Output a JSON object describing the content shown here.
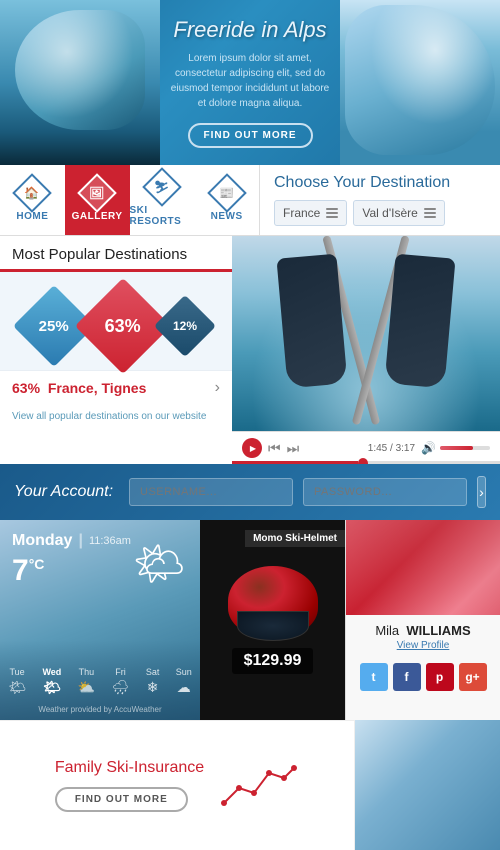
{
  "hero": {
    "title": "Freeride in Alps",
    "description": "Lorem ipsum dolor sit amet, consectetur adipiscing elit, sed do eiusmod tempor incididunt ut labore et dolore magna aliqua.",
    "button_label": "FIND OUT MORE"
  },
  "nav": {
    "tabs": [
      {
        "id": "home",
        "label": "HOME",
        "icon": "house"
      },
      {
        "id": "gallery",
        "label": "GALLERY",
        "icon": "image",
        "active": true
      },
      {
        "id": "ski-resorts",
        "label": "SKI RESORTS",
        "icon": "mountain"
      },
      {
        "id": "news",
        "label": "NEWS",
        "icon": "newspaper"
      }
    ]
  },
  "destination": {
    "title": "Choose Your Destination",
    "country": "France",
    "resort": "Val d'Isère"
  },
  "popular": {
    "title": "Most Popular Destinations",
    "diamonds": [
      {
        "label": "25%",
        "size": "medium",
        "color": "blue"
      },
      {
        "label": "63%",
        "size": "large",
        "color": "red"
      },
      {
        "label": "12%",
        "size": "small",
        "color": "dark"
      }
    ],
    "stat_percent": "63%",
    "stat_location": "France, Tignes",
    "link_text": "View all popular destinations on our website"
  },
  "video": {
    "current_time": "1:45",
    "total_time": "3:17"
  },
  "account": {
    "label": "Your Account:",
    "username_placeholder": "USERNAME...",
    "password_placeholder": "PASSWORD..."
  },
  "weather": {
    "day": "Monday",
    "time": "11:36am",
    "temp": "7",
    "unit": "°C",
    "icon": "🌤",
    "days": [
      {
        "label": "Tue",
        "icon": "🌤"
      },
      {
        "label": "Wed",
        "icon": "🌤",
        "active": true
      },
      {
        "label": "Thu",
        "icon": "⛅"
      },
      {
        "label": "Fri",
        "icon": "🌧"
      },
      {
        "label": "Sat",
        "icon": "❄"
      },
      {
        "label": "Sun",
        "icon": "☁"
      }
    ],
    "credit": "Weather provided by AccuWeather"
  },
  "helmet": {
    "name": "Momo Ski-Helmet",
    "price": "$129.99"
  },
  "profile": {
    "first_name": "Mila",
    "last_name": "WILLIAMS",
    "link": "View Profile",
    "social": [
      "t",
      "f",
      "p",
      "g+"
    ]
  },
  "insurance": {
    "title": "Family Ski-Insurance",
    "button_label": "FIND OUT MORE"
  },
  "colors": {
    "red": "#cc2230",
    "blue": "#2a7ab0",
    "dark_blue": "#1a4a6a"
  }
}
